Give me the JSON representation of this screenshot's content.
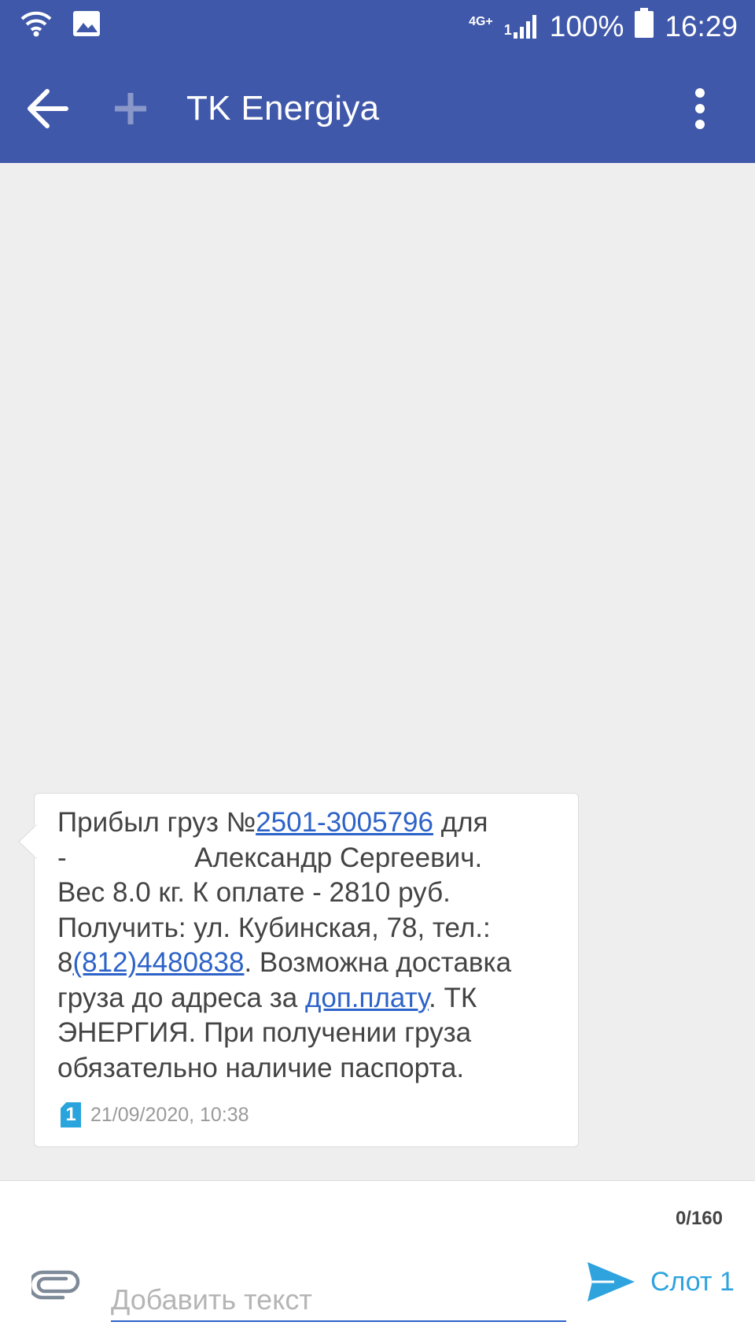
{
  "status_bar": {
    "network_type": "4G+",
    "sim_indicator": "1",
    "battery": "100%",
    "time": "16:29",
    "icons": [
      "wifi-icon",
      "image-icon",
      "signal-icon",
      "battery-icon"
    ]
  },
  "app_bar": {
    "title": "TK Energiya",
    "icons": [
      "back-arrow-icon",
      "add-icon",
      "more-vert-icon"
    ]
  },
  "message": {
    "line1_prefix": "Прибыл груз №",
    "cargo_number": "2501-3005796",
    "line1_suffix": " для\n- ",
    "line2": " Александр Сергеевич.\nВес 8.0 кг. К оплате - 2810 руб.\nПолучить: ул. Кубинская, 78, тел.:\n8",
    "phone": "(812)4480838",
    "line3": ". Возможна доставка\nгруза до адреса за ",
    "link_text": "доп.плату",
    "line4": ". ТК\nЭНЕРГИЯ. При получении груза\nобязательно наличие паспорта.",
    "sim_slot": "1",
    "timestamp": "21/09/2020, 10:38"
  },
  "composer": {
    "char_count": "0/160",
    "placeholder": "Добавить текст",
    "value": "",
    "send_label": "Слот 1"
  },
  "colors": {
    "app_bar": "#4058a9",
    "link": "#2d63c8",
    "send": "#2ea3de",
    "sim_badge": "#29a4dc",
    "background": "#eeeeee"
  }
}
